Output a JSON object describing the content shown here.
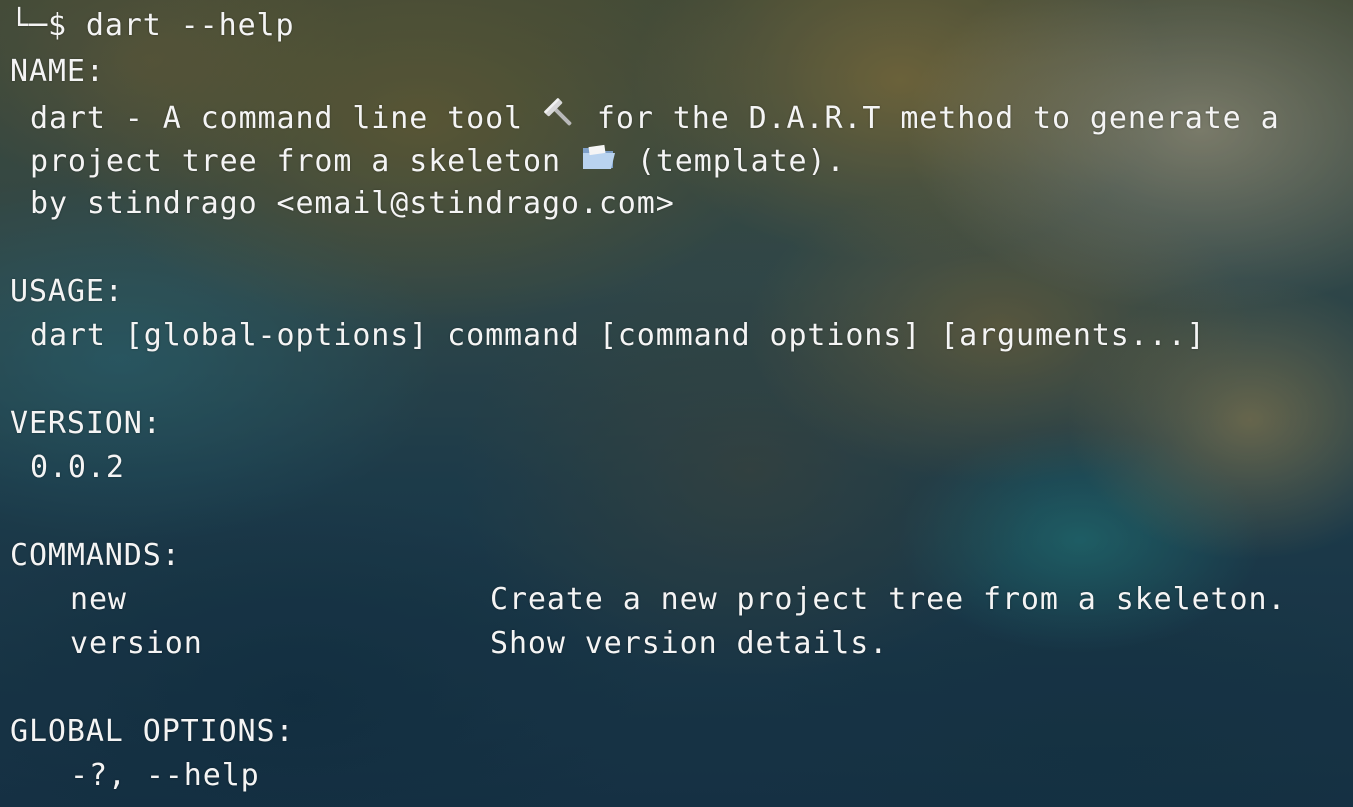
{
  "prompt_line": {
    "corner": "└─",
    "dollar": "$",
    "command": "dart --help"
  },
  "name_section": {
    "header": "NAME:",
    "line1_before": "dart - A command line tool ",
    "line1_after": " for the D.A.R.T method to generate a",
    "line2_before": "project tree from a skeleton ",
    "line2_after": " (template).",
    "line3": "by stindrago <email@stindrago.com>",
    "icons": [
      "hammer-icon",
      "folder-icon"
    ]
  },
  "usage_section": {
    "header": "USAGE:",
    "text": "dart [global-options] command [command options] [arguments...]"
  },
  "version_section": {
    "header": "VERSION:",
    "text": "0.0.2"
  },
  "commands_section": {
    "header": "COMMANDS:",
    "items": [
      {
        "name": "new",
        "description": "Create a new project tree from a skeleton."
      },
      {
        "name": "version",
        "description": "Show version details."
      }
    ]
  },
  "global_options_section": {
    "header": "GLOBAL OPTIONS:",
    "items": [
      {
        "flag": "-?, --help"
      }
    ]
  }
}
